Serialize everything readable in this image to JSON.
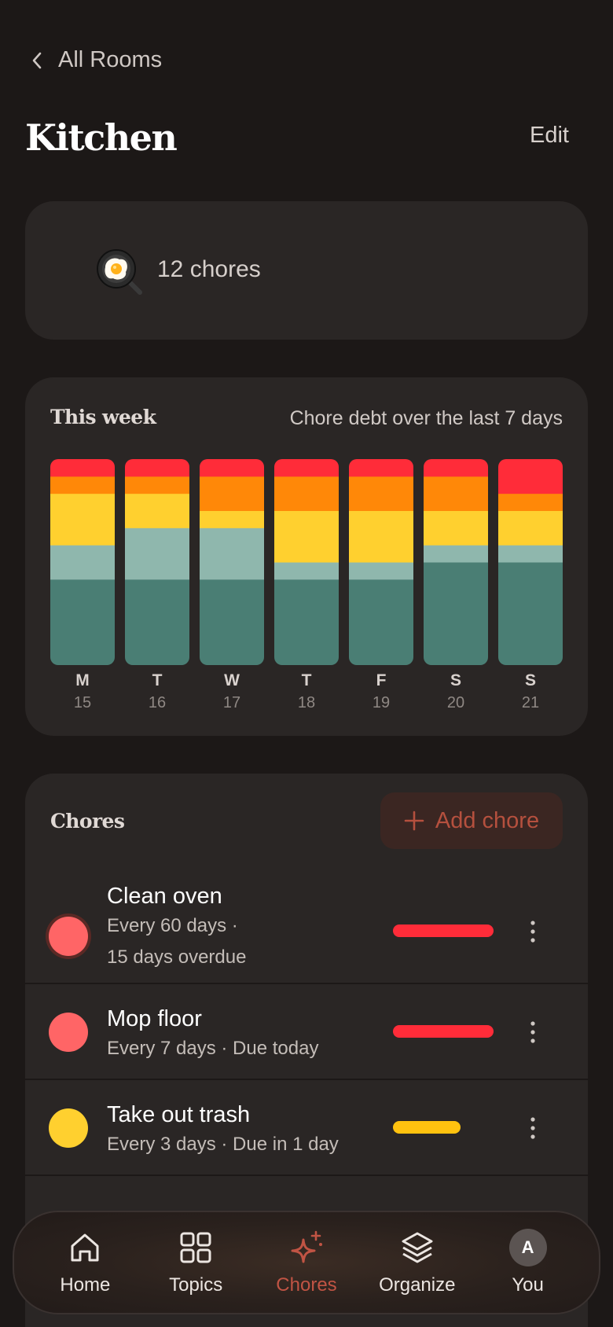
{
  "header": {
    "back_label": "All Rooms",
    "title": "Kitchen",
    "edit_label": "Edit"
  },
  "summary": {
    "emoji": "fried-egg-pan",
    "chore_count": "12 chores"
  },
  "week": {
    "title": "This week",
    "subtitle": "Chore debt over the last 7 days"
  },
  "chart_data": {
    "type": "bar",
    "stacked": true,
    "categories": [
      "M",
      "T",
      "W",
      "T",
      "F",
      "S",
      "S"
    ],
    "dates": [
      "15",
      "16",
      "17",
      "18",
      "19",
      "20",
      "21"
    ],
    "series": [
      {
        "color": "#4a7e74",
        "values": [
          5,
          5,
          5,
          5,
          5,
          6,
          6
        ]
      },
      {
        "color": "#8fb7ad",
        "values": [
          2,
          3,
          3,
          1,
          1,
          1,
          1
        ]
      },
      {
        "color": "#ffd02f",
        "values": [
          3,
          2,
          1,
          3,
          3,
          2,
          2
        ]
      },
      {
        "color": "#ff8808",
        "values": [
          1,
          1,
          2,
          2,
          2,
          2,
          1
        ]
      },
      {
        "color": "#ff2c39",
        "values": [
          1,
          1,
          1,
          1,
          1,
          1,
          2
        ]
      }
    ],
    "ylim": [
      0,
      12
    ],
    "legend": "none",
    "grid": false
  },
  "chores": {
    "title": "Chores",
    "add_label": "Add chore",
    "items": [
      {
        "name": "Clean oven",
        "meta_line1": "Every 60 days ·",
        "meta_line2": "15 days overdue",
        "dot_color": "#ff6566",
        "bar_color": "#ff2c39",
        "debt": 1.0
      },
      {
        "name": "Mop floor",
        "meta_line1": "Every 7 days · Due today",
        "dot_color": "#ff6566",
        "bar_color": "#ff2c39",
        "debt": 1.0
      },
      {
        "name": "Take out trash",
        "meta_line1": "Every 3 days · Due in 1 day",
        "dot_color": "#ffd02f",
        "bar_color": "#ffc20f",
        "debt": 0.67
      }
    ]
  },
  "tabs": [
    {
      "label": "Home",
      "icon": "home-icon"
    },
    {
      "label": "Topics",
      "icon": "grid-icon"
    },
    {
      "label": "Chores",
      "icon": "sparkle-icon",
      "active": true
    },
    {
      "label": "Organize",
      "icon": "layers-icon"
    },
    {
      "label": "You",
      "icon": "avatar",
      "initial": "A"
    }
  ]
}
